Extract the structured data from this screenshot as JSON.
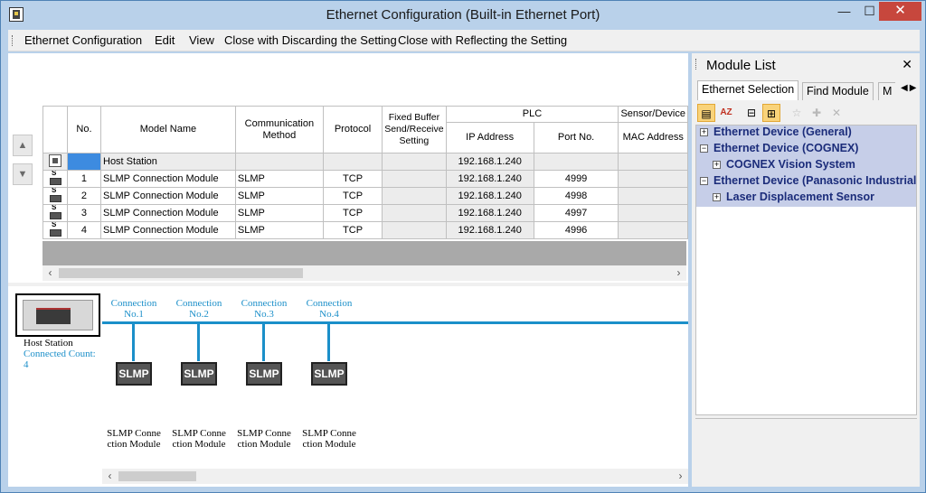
{
  "window": {
    "title": "Ethernet Configuration (Built-in Ethernet Port)",
    "min_glyph": "—",
    "max_glyph": "☐",
    "close_glyph": "✕",
    "icon": "app-icon"
  },
  "menu": {
    "items": [
      "Ethernet Configuration",
      "Edit",
      "View",
      "Close with Discarding the Setting",
      "Close with Reflecting the Setting"
    ]
  },
  "grid": {
    "headers": {
      "no": "No.",
      "model": "Model Name",
      "comm": "Communication Method",
      "protocol": "Protocol",
      "fixed": "Fixed Buffer Send/Receive Setting",
      "plc": "PLC",
      "ip": "IP Address",
      "port": "Port No.",
      "sensor": "Sensor/Device",
      "mac": "MAC Address"
    },
    "rows": [
      {
        "icon": "host-station-icon",
        "no": "",
        "model": "Host Station",
        "comm": "",
        "protocol": "",
        "ip": "192.168.1.240",
        "port": ""
      },
      {
        "icon": "slmp-module-icon",
        "no": "1",
        "model": "SLMP Connection Module",
        "comm": "SLMP",
        "protocol": "TCP",
        "ip": "192.168.1.240",
        "port": "4999"
      },
      {
        "icon": "slmp-module-icon",
        "no": "2",
        "model": "SLMP Connection Module",
        "comm": "SLMP",
        "protocol": "TCP",
        "ip": "192.168.1.240",
        "port": "4998"
      },
      {
        "icon": "slmp-module-icon",
        "no": "3",
        "model": "SLMP Connection Module",
        "comm": "SLMP",
        "protocol": "TCP",
        "ip": "192.168.1.240",
        "port": "4997"
      },
      {
        "icon": "slmp-module-icon",
        "no": "4",
        "model": "SLMP Connection Module",
        "comm": "SLMP",
        "protocol": "TCP",
        "ip": "192.168.1.240",
        "port": "4996"
      }
    ]
  },
  "diagram": {
    "host_label": "Host Station",
    "connected_count_label": "Connected Count:",
    "connected_count": "4",
    "connections": [
      {
        "label1": "Connection",
        "label2": "No.1",
        "box": "SLMP",
        "module": "SLMP Connection Module"
      },
      {
        "label1": "Connection",
        "label2": "No.2",
        "box": "SLMP",
        "module": "SLMP Connection Module"
      },
      {
        "label1": "Connection",
        "label2": "No.3",
        "box": "SLMP",
        "module": "SLMP Connection Module"
      },
      {
        "label1": "Connection",
        "label2": "No.4",
        "box": "SLMP",
        "module": "SLMP Connection Module"
      }
    ]
  },
  "module_list": {
    "title": "Module List",
    "close_glyph": "✕",
    "tabs": [
      "Ethernet Selection",
      "Find Module",
      "M"
    ],
    "tree": [
      {
        "label": "Ethernet Device (General)",
        "sub": false,
        "expanded": false
      },
      {
        "label": "Ethernet Device (COGNEX)",
        "sub": false,
        "expanded": true
      },
      {
        "label": "COGNEX Vision System",
        "sub": true,
        "expanded": false
      },
      {
        "label": "Ethernet Device (Panasonic Industrial)",
        "sub": false,
        "expanded": true
      },
      {
        "label": "Laser Displacement Sensor",
        "sub": true,
        "expanded": false
      }
    ]
  },
  "colors": {
    "accent": "#1b8fc9",
    "tree_bg": "#c6cee8",
    "tree_text": "#1b2c7a",
    "close_red": "#c7473d"
  }
}
